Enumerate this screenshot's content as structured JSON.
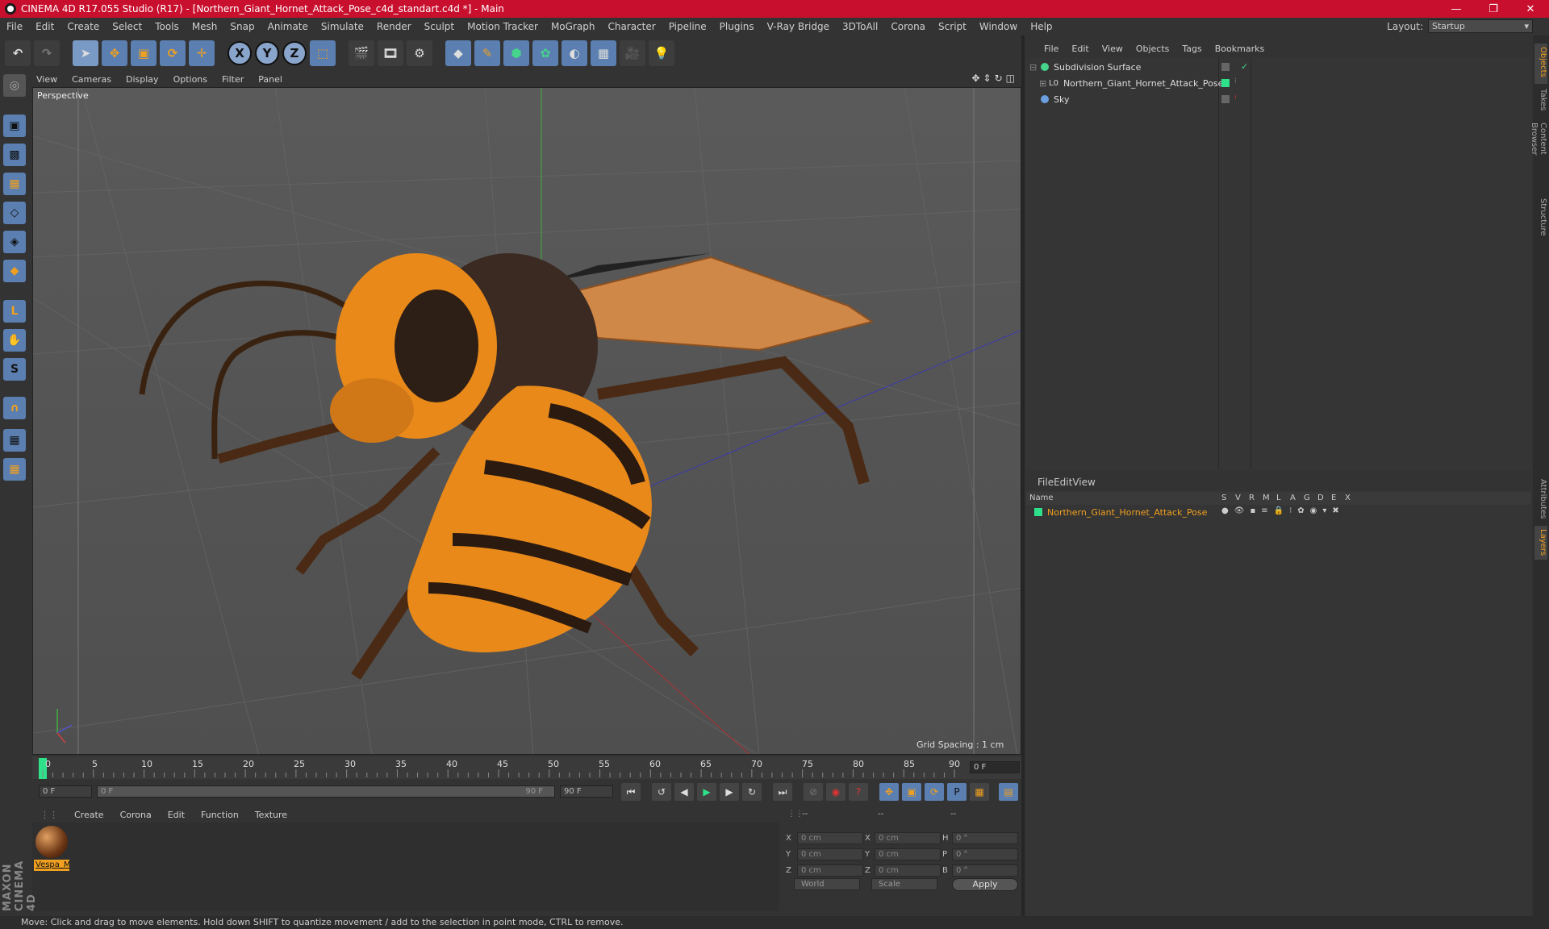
{
  "window": {
    "title": "CINEMA 4D R17.055 Studio (R17) - [Northern_Giant_Hornet_Attack_Pose_c4d_standart.c4d *] - Main",
    "min": "—",
    "max": "❐",
    "close": "✕"
  },
  "menu": [
    "File",
    "Edit",
    "Create",
    "Select",
    "Tools",
    "Mesh",
    "Snap",
    "Animate",
    "Simulate",
    "Render",
    "Sculpt",
    "Motion Tracker",
    "MoGraph",
    "Character",
    "Pipeline",
    "Plugins",
    "V-Ray Bridge",
    "3DToAll",
    "Corona",
    "Script",
    "Window",
    "Help"
  ],
  "layout": {
    "label": "Layout:",
    "value": "Startup"
  },
  "viewport": {
    "menu": [
      "View",
      "Cameras",
      "Display",
      "Options",
      "Filter",
      "Panel"
    ],
    "label": "Perspective",
    "grid_spacing": "Grid Spacing : 1 cm"
  },
  "timeline": {
    "ticks": [
      "0",
      "5",
      "10",
      "15",
      "20",
      "25",
      "30",
      "35",
      "40",
      "45",
      "50",
      "55",
      "60",
      "65",
      "70",
      "75",
      "80",
      "85",
      "90"
    ],
    "current_frame": "0 F",
    "start": "0 F",
    "range_start": "0 F",
    "range_end": "90 F",
    "end": "90 F"
  },
  "material_manager": {
    "menu": [
      "Create",
      "Corona",
      "Edit",
      "Function",
      "Texture"
    ],
    "material_name": "Vespa_M"
  },
  "coordinates": {
    "header": [
      "--",
      "--",
      "--"
    ],
    "rows": [
      {
        "a": "X",
        "av": "0 cm",
        "b": "X",
        "bv": "0 cm",
        "c": "H",
        "cv": "0 °"
      },
      {
        "a": "Y",
        "av": "0 cm",
        "b": "Y",
        "bv": "0 cm",
        "c": "P",
        "cv": "0 °"
      },
      {
        "a": "Z",
        "av": "0 cm",
        "b": "Z",
        "bv": "0 cm",
        "c": "B",
        "cv": "0 °"
      }
    ],
    "mode1": "World",
    "mode2": "Scale",
    "apply": "Apply"
  },
  "objects": {
    "menu": [
      "File",
      "Edit",
      "View",
      "Objects",
      "Tags",
      "Bookmarks"
    ],
    "items": [
      {
        "name": "Subdivision Surface",
        "color": "#46d48c"
      },
      {
        "name": "Northern_Giant_Hornet_Attack_Pose",
        "color": "#2ee08a"
      },
      {
        "name": "Sky",
        "color": "#6aa0e0"
      }
    ]
  },
  "layers": {
    "menu": [
      "File",
      "Edit",
      "View"
    ],
    "columns": [
      "Name",
      "S",
      "V",
      "R",
      "M",
      "L",
      "A",
      "G",
      "D",
      "E",
      "X"
    ],
    "items": [
      {
        "name": "Northern_Giant_Hornet_Attack_Pose"
      }
    ]
  },
  "right_tabs": [
    "Objects",
    "Takes",
    "Content Browser",
    "Structure",
    "Attributes",
    "Layers"
  ],
  "branding": "MAXON CINEMA 4D",
  "status": "Move: Click and drag to move elements. Hold down SHIFT to quantize movement / add to the selection in point mode, CTRL to remove.",
  "colors": {
    "title_bar": "#c8102e",
    "accent": "#f0a020",
    "tool_blue": "#5b7fb0"
  }
}
